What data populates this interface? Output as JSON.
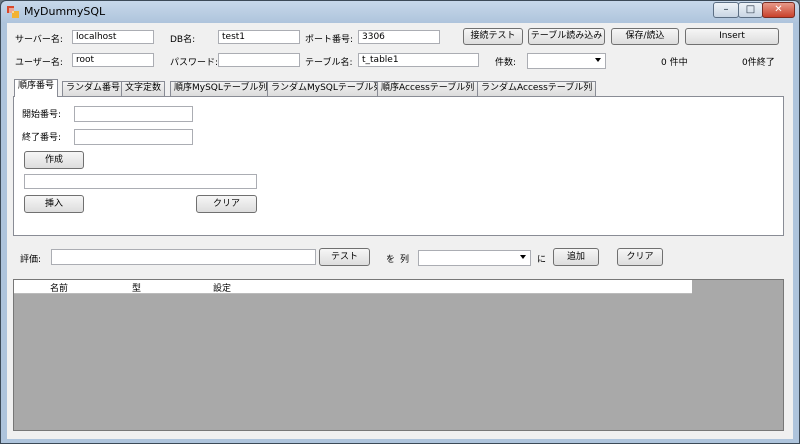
{
  "window": {
    "title": "MyDummySQL",
    "minimize_glyph": "–",
    "maximize_glyph": "□",
    "close_glyph": "✕"
  },
  "connection": {
    "server_label": "サーバー名:",
    "server_value": "localhost",
    "db_label": "DB名:",
    "db_value": "test1",
    "port_label": "ポート番号:",
    "port_value": "3306",
    "user_label": "ユーザー名:",
    "user_value": "root",
    "password_label": "パスワード:",
    "password_value": "",
    "table_label": "テーブル名:",
    "table_value": "t_table1",
    "count_label": "件数:",
    "count_value": ""
  },
  "toolbar": {
    "test_connection": "接続テスト",
    "load_table": "テーブル読み込み",
    "save_load": "保存/読込",
    "insert": "Insert"
  },
  "status": {
    "in_progress": "0 件中",
    "done": "0件終了"
  },
  "tabs": [
    {
      "label": "順序番号"
    },
    {
      "label": "ランダム番号"
    },
    {
      "label": "文字定数"
    },
    {
      "label": "順序MySQLテーブル列"
    },
    {
      "label": "ランダムMySQLテーブル列"
    },
    {
      "label": "順序Accessテーブル列"
    },
    {
      "label": "ランダムAccessテーブル列"
    }
  ],
  "sequence_tab": {
    "start_label": "開始番号:",
    "start_value": "",
    "end_label": "終了番号:",
    "end_value": "",
    "create_button": "作成",
    "output_value": "",
    "insert_button": "挿入",
    "clear_button": "クリア"
  },
  "evaluation": {
    "label": "評価:",
    "value": "",
    "test_button": "テスト",
    "wo_label": "を",
    "column_label": "列",
    "column_value": "",
    "ni_label": "に",
    "add_button": "追加",
    "clear_button": "クリア"
  },
  "grid": {
    "headers": [
      "名前",
      "型",
      "設定"
    ]
  }
}
